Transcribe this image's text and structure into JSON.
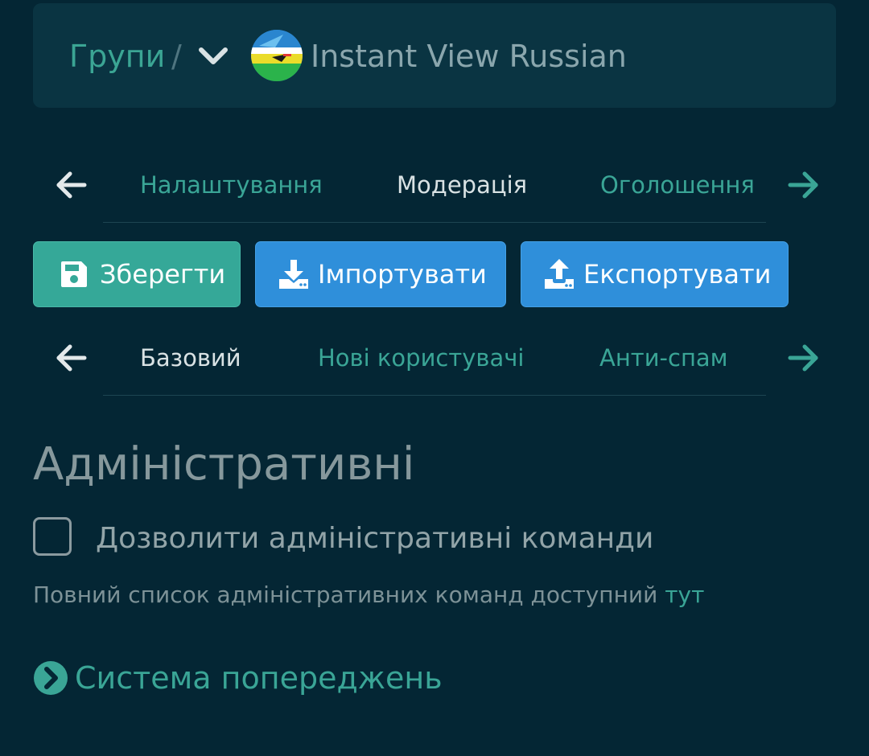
{
  "breadcrumb": {
    "groups_label": "Групи",
    "separator": "/",
    "group_name": "Instant View Russian"
  },
  "main_tabs": {
    "items": [
      {
        "label": "Налаштування",
        "active": false
      },
      {
        "label": "Модерація",
        "active": true
      },
      {
        "label": "Оголошення",
        "active": false
      }
    ]
  },
  "actions": {
    "save_label": "Зберегти",
    "import_label": "Імпортувати",
    "export_label": "Експортувати"
  },
  "sub_tabs": {
    "items": [
      {
        "label": "Базовий",
        "active": true
      },
      {
        "label": "Нові користувачі",
        "active": false
      },
      {
        "label": "Анти-спам",
        "active": false
      }
    ]
  },
  "section": {
    "title": "Адміністративні",
    "checkbox_label": "Дозволити адміністративні команди",
    "checkbox_checked": false,
    "help_text": "Повний список адміністративних команд доступний",
    "help_link": "тут"
  },
  "collapsible": {
    "label": "Система попереджень"
  },
  "colors": {
    "background": "#042634",
    "card": "#0a3442",
    "accent_teal": "#3aa596",
    "button_teal": "#35a898",
    "button_blue": "#2f8fda"
  }
}
